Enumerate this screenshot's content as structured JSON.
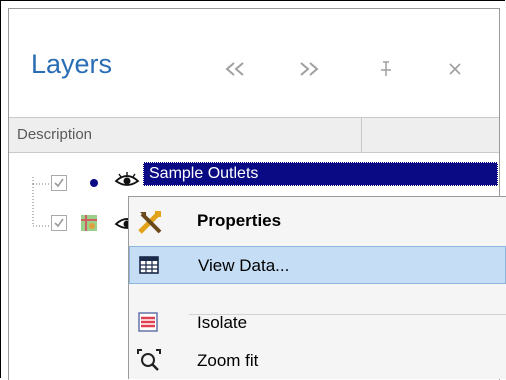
{
  "panel": {
    "title": "Layers",
    "buttons": [
      {
        "name": "collapse-left",
        "icon": "double-chevron-left-icon",
        "glyph": "≪"
      },
      {
        "name": "expand-right",
        "icon": "double-chevron-right-icon",
        "glyph": "≫"
      },
      {
        "name": "pin",
        "icon": "pin-icon",
        "glyph": "⊥"
      },
      {
        "name": "close",
        "icon": "close-icon",
        "glyph": "✕"
      }
    ]
  },
  "table": {
    "column_header": "Description"
  },
  "layers": [
    {
      "label": "Sample Outlets",
      "checked": true,
      "visible": true,
      "selected": true,
      "icon": "point-icon"
    },
    {
      "label": "",
      "checked": true,
      "visible": true,
      "selected": false,
      "icon": "map-layer-icon"
    }
  ],
  "context_menu": {
    "items": [
      {
        "label": "Properties",
        "icon": "tools-icon",
        "bold": true,
        "highlighted": false
      },
      {
        "label": "View Data...",
        "icon": "table-icon",
        "bold": false,
        "highlighted": true
      },
      {
        "label": "Isolate",
        "icon": "isolate-icon",
        "bold": false,
        "highlighted": false
      },
      {
        "label": "Zoom fit",
        "icon": "zoom-fit-icon",
        "bold": false,
        "highlighted": false
      }
    ]
  },
  "colors": {
    "title": "#2a6db5",
    "selection": "#0a0a85",
    "menu_highlight": "#c5def5"
  }
}
